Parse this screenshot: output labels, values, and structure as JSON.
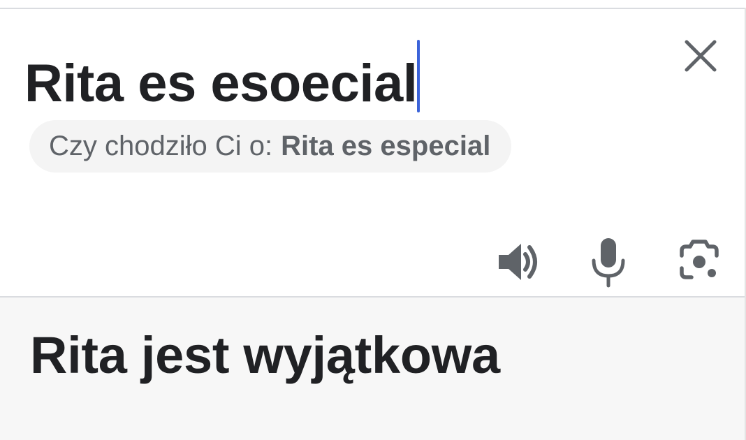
{
  "source": {
    "text": "Rita es esoecial"
  },
  "suggestion": {
    "prefix": "Czy chodziło Ci o:",
    "value": "Rita es especial"
  },
  "toolbar": {
    "icons": [
      "clear-icon",
      "speaker-icon",
      "microphone-icon",
      "camera-lens-icon"
    ]
  },
  "translation": {
    "text": "Rita jest wyjątkowa"
  },
  "colors": {
    "caret": "#3b63d9",
    "text": "#202124",
    "icon": "#5f6368",
    "chip_bg": "#f4f4f4",
    "output_bg": "#f7f7f7"
  }
}
